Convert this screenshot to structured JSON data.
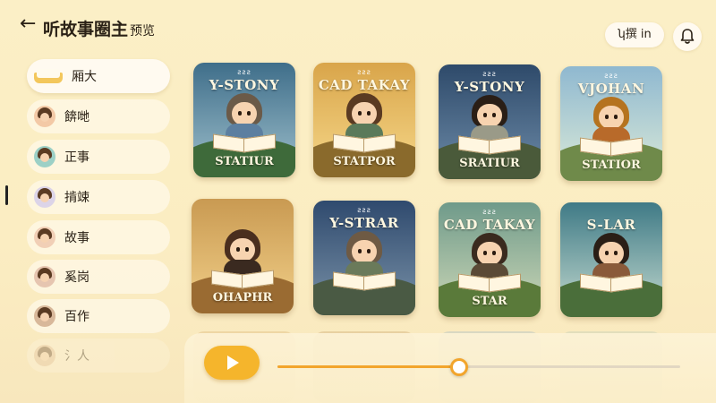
{
  "header": {
    "back_icon": "arrow-left-icon",
    "title": "听故事圈主",
    "title_suffix": "预览",
    "lang_label": "ʮ撰 in",
    "bell_icon": "bell-icon"
  },
  "sidebar": {
    "items": [
      {
        "label": "厢大",
        "thumb": "book"
      },
      {
        "label": "餴哋",
        "thumb": "avatar"
      },
      {
        "label": "正事",
        "thumb": "avatar"
      },
      {
        "label": "掯竦",
        "thumb": "avatar"
      },
      {
        "label": "故事",
        "thumb": "avatar"
      },
      {
        "label": "奚岗",
        "thumb": "avatar"
      },
      {
        "label": "百作",
        "thumb": "avatar"
      },
      {
        "label": "氵人",
        "thumb": "avatar"
      }
    ]
  },
  "cards": [
    {
      "top": "ƨƨƨ",
      "title": "Y-STONY",
      "bottom": "STATIUR",
      "bg": "#3f6e8a",
      "bg2": "#9fc0cc",
      "hill": "#3e6a3a",
      "hair": "#6b5a48",
      "shirt": "#5c7fa0"
    },
    {
      "top": "ƨƨƨ",
      "title": "CAD TAKAY",
      "bottom": "STATPOR",
      "bg": "#d9a54a",
      "bg2": "#f6d88a",
      "hill": "#8a6a2c",
      "hair": "#5a3a22",
      "shirt": "#5a7a5a"
    },
    {
      "top": "ƨƨƨ",
      "title": "Y-STONY",
      "bottom": "SRATIUR",
      "bg": "#2e4a6a",
      "bg2": "#6d8ba8",
      "hill": "#4a5a3a",
      "hair": "#2a1e16",
      "shirt": "#9a9a88"
    },
    {
      "top": "ƨƨƨ",
      "title": "VJOHAN",
      "bottom": "STATIOR",
      "bg": "#8fb8d0",
      "bg2": "#dcebd8",
      "hill": "#6f8a4a",
      "hair": "#b5731f",
      "shirt": "#b86a2a"
    },
    {
      "top": "",
      "title": "",
      "bottom": "OHAPHR",
      "bg": "#c99a52",
      "bg2": "#f2d089",
      "hill": "#9a6b32",
      "hair": "#4a2e1e",
      "shirt": "#3a2a20"
    },
    {
      "top": "ƨƨƨ",
      "title": "Y-STRAR",
      "bottom": "",
      "bg": "#2f4a6e",
      "bg2": "#7a92a8",
      "hill": "#4a5a44",
      "hair": "#6e5a44",
      "shirt": "#6a7a5a"
    },
    {
      "top": "ƨƨƨ",
      "title": "CAD TAKAY",
      "bottom": "STAR",
      "bg": "#6f9a8a",
      "bg2": "#cfd9b8",
      "hill": "#5a7a3a",
      "hair": "#3a2a1e",
      "shirt": "#5a4a36"
    },
    {
      "top": "",
      "title": "S-LAR",
      "bottom": "",
      "bg": "#3f7a86",
      "bg2": "#c5dbd0",
      "hill": "#4a6e3a",
      "hair": "#2a1e16",
      "shirt": "#8a5a3a"
    }
  ],
  "player": {
    "play_icon": "play-icon",
    "progress": 0.45
  }
}
